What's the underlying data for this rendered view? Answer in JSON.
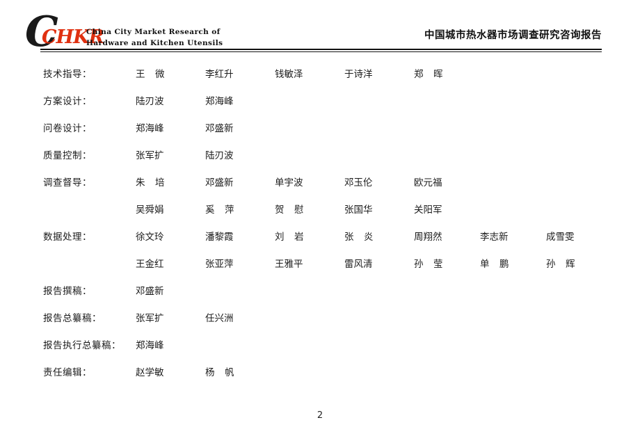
{
  "document": {
    "page_number": "2",
    "background_color": "#ffffff",
    "text_color": "#1c1c1c"
  },
  "header": {
    "logo": {
      "c_letter": "C",
      "wordmark": "CHKR",
      "wordmark_color": "#e03010",
      "c_color": "#1a1a1a",
      "tagline_line1": "China  City  Market  Research  of",
      "tagline_line2": "Hardware  and  Kitchen  Utensils"
    },
    "title": "中国城市热水器市场调查研究咨询报告"
  },
  "credits": {
    "rows": [
      {
        "label": "技术指导：",
        "names": [
          "王　微",
          "李红升",
          "钱敏泽",
          "于诗洋",
          "郑　晖"
        ]
      },
      {
        "label": "方案设计：",
        "names": [
          "陆刃波",
          "郑海峰"
        ]
      },
      {
        "label": "问卷设计：",
        "names": [
          "郑海峰",
          "邓盛新"
        ]
      },
      {
        "label": "质量控制：",
        "names": [
          "张军扩",
          "陆刃波"
        ]
      },
      {
        "label": "调查督导：",
        "names": [
          "朱　培",
          "邓盛新",
          "单宇波",
          "邓玉伦",
          "欧元福"
        ]
      },
      {
        "label": "",
        "names": [
          "吴舜娟",
          "奚　萍",
          "贺　慰",
          "张国华",
          "关阳军"
        ]
      },
      {
        "label": "数据处理：",
        "names": [
          "徐文玲",
          "潘黎霞",
          "刘　岩",
          "张　炎",
          "周翔然",
          "李志新",
          "成雪雯"
        ]
      },
      {
        "label": "",
        "names": [
          "王金红",
          "张亚萍",
          "王雅平",
          "雷风清",
          "孙　莹",
          "单　鹏",
          "孙　辉"
        ]
      },
      {
        "label": "报告撰稿：",
        "names": [
          "邓盛新"
        ]
      },
      {
        "label": "报告总纂稿：",
        "names": [
          "张军扩",
          "任兴洲"
        ]
      },
      {
        "label": "报告执行总纂稿：",
        "names": [
          "郑海峰"
        ]
      },
      {
        "label": "责任编辑：",
        "names": [
          "赵学敏",
          "杨　帆"
        ]
      }
    ]
  }
}
